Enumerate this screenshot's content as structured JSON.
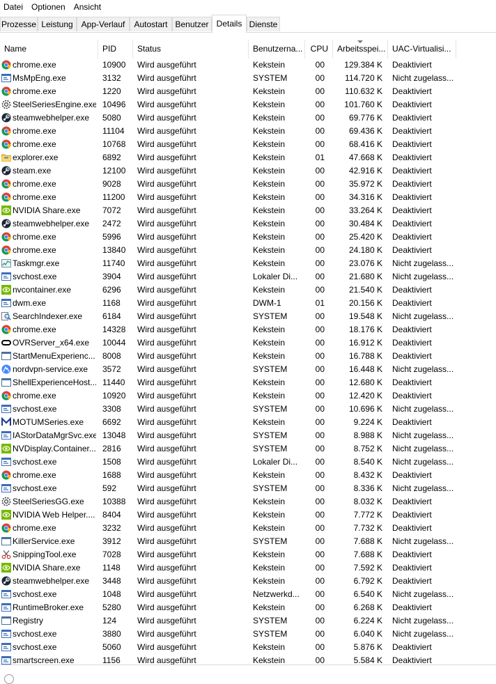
{
  "menu": [
    "Datei",
    "Optionen",
    "Ansicht"
  ],
  "tabs": [
    "Prozesse",
    "Leistung",
    "App-Verlauf",
    "Autostart",
    "Benutzer",
    "Details",
    "Dienste"
  ],
  "active_tab": "Details",
  "columns": [
    "Name",
    "PID",
    "Status",
    "Benutzerna...",
    "CPU",
    "Arbeitsspei...",
    "UAC-Virtualisi..."
  ],
  "sort_column": "Arbeitsspei...",
  "processes": [
    {
      "name": "chrome.exe",
      "pid": "10900",
      "status": "Wird ausgeführt",
      "user": "Kekstein",
      "cpu": "00",
      "mem": "129.384 K",
      "uac": "Deaktiviert",
      "icon": "chrome-icon"
    },
    {
      "name": "MsMpEng.exe",
      "pid": "3132",
      "status": "Wird ausgeführt",
      "user": "SYSTEM",
      "cpu": "00",
      "mem": "114.720 K",
      "uac": "Nicht zugelass...",
      "icon": "service-icon"
    },
    {
      "name": "chrome.exe",
      "pid": "1220",
      "status": "Wird ausgeführt",
      "user": "Kekstein",
      "cpu": "00",
      "mem": "110.632 K",
      "uac": "Deaktiviert",
      "icon": "chrome-icon"
    },
    {
      "name": "SteelSeriesEngine.exe",
      "pid": "10496",
      "status": "Wird ausgeführt",
      "user": "Kekstein",
      "cpu": "00",
      "mem": "101.760 K",
      "uac": "Deaktiviert",
      "icon": "steelseries-icon"
    },
    {
      "name": "steamwebhelper.exe",
      "pid": "5080",
      "status": "Wird ausgeführt",
      "user": "Kekstein",
      "cpu": "00",
      "mem": "69.776 K",
      "uac": "Deaktiviert",
      "icon": "steam-icon"
    },
    {
      "name": "chrome.exe",
      "pid": "11104",
      "status": "Wird ausgeführt",
      "user": "Kekstein",
      "cpu": "00",
      "mem": "69.436 K",
      "uac": "Deaktiviert",
      "icon": "chrome-icon"
    },
    {
      "name": "chrome.exe",
      "pid": "10768",
      "status": "Wird ausgeführt",
      "user": "Kekstein",
      "cpu": "00",
      "mem": "68.416 K",
      "uac": "Deaktiviert",
      "icon": "chrome-icon"
    },
    {
      "name": "explorer.exe",
      "pid": "6892",
      "status": "Wird ausgeführt",
      "user": "Kekstein",
      "cpu": "01",
      "mem": "47.668 K",
      "uac": "Deaktiviert",
      "icon": "folder-icon"
    },
    {
      "name": "steam.exe",
      "pid": "12100",
      "status": "Wird ausgeführt",
      "user": "Kekstein",
      "cpu": "00",
      "mem": "42.916 K",
      "uac": "Deaktiviert",
      "icon": "steam-icon"
    },
    {
      "name": "chrome.exe",
      "pid": "9028",
      "status": "Wird ausgeführt",
      "user": "Kekstein",
      "cpu": "00",
      "mem": "35.972 K",
      "uac": "Deaktiviert",
      "icon": "chrome-icon"
    },
    {
      "name": "chrome.exe",
      "pid": "11200",
      "status": "Wird ausgeführt",
      "user": "Kekstein",
      "cpu": "00",
      "mem": "34.316 K",
      "uac": "Deaktiviert",
      "icon": "chrome-icon"
    },
    {
      "name": "NVIDIA Share.exe",
      "pid": "7072",
      "status": "Wird ausgeführt",
      "user": "Kekstein",
      "cpu": "00",
      "mem": "33.264 K",
      "uac": "Deaktiviert",
      "icon": "nvidia-icon"
    },
    {
      "name": "steamwebhelper.exe",
      "pid": "2472",
      "status": "Wird ausgeführt",
      "user": "Kekstein",
      "cpu": "00",
      "mem": "30.484 K",
      "uac": "Deaktiviert",
      "icon": "steam-icon"
    },
    {
      "name": "chrome.exe",
      "pid": "5996",
      "status": "Wird ausgeführt",
      "user": "Kekstein",
      "cpu": "00",
      "mem": "25.420 K",
      "uac": "Deaktiviert",
      "icon": "chrome-icon"
    },
    {
      "name": "chrome.exe",
      "pid": "13840",
      "status": "Wird ausgeführt",
      "user": "Kekstein",
      "cpu": "00",
      "mem": "24.180 K",
      "uac": "Deaktiviert",
      "icon": "chrome-icon"
    },
    {
      "name": "Taskmgr.exe",
      "pid": "11740",
      "status": "Wird ausgeführt",
      "user": "Kekstein",
      "cpu": "00",
      "mem": "23.076 K",
      "uac": "Nicht zugelass...",
      "icon": "taskmgr-icon"
    },
    {
      "name": "svchost.exe",
      "pid": "3904",
      "status": "Wird ausgeführt",
      "user": "Lokaler Di...",
      "cpu": "00",
      "mem": "21.680 K",
      "uac": "Nicht zugelass...",
      "icon": "service-icon"
    },
    {
      "name": "nvcontainer.exe",
      "pid": "6296",
      "status": "Wird ausgeführt",
      "user": "Kekstein",
      "cpu": "00",
      "mem": "21.540 K",
      "uac": "Deaktiviert",
      "icon": "nvidia-icon"
    },
    {
      "name": "dwm.exe",
      "pid": "1168",
      "status": "Wird ausgeführt",
      "user": "DWM-1",
      "cpu": "01",
      "mem": "20.156 K",
      "uac": "Deaktiviert",
      "icon": "service-icon"
    },
    {
      "name": "SearchIndexer.exe",
      "pid": "6184",
      "status": "Wird ausgeführt",
      "user": "SYSTEM",
      "cpu": "00",
      "mem": "19.548 K",
      "uac": "Nicht zugelass...",
      "icon": "search-indexer-icon"
    },
    {
      "name": "chrome.exe",
      "pid": "14328",
      "status": "Wird ausgeführt",
      "user": "Kekstein",
      "cpu": "00",
      "mem": "18.176 K",
      "uac": "Deaktiviert",
      "icon": "chrome-icon"
    },
    {
      "name": "OVRServer_x64.exe",
      "pid": "10044",
      "status": "Wird ausgeführt",
      "user": "Kekstein",
      "cpu": "00",
      "mem": "16.912 K",
      "uac": "Deaktiviert",
      "icon": "oculus-icon"
    },
    {
      "name": "StartMenuExperienc...",
      "pid": "8008",
      "status": "Wird ausgeführt",
      "user": "Kekstein",
      "cpu": "00",
      "mem": "16.788 K",
      "uac": "Deaktiviert",
      "icon": "window-icon"
    },
    {
      "name": "nordvpn-service.exe",
      "pid": "3572",
      "status": "Wird ausgeführt",
      "user": "SYSTEM",
      "cpu": "00",
      "mem": "16.448 K",
      "uac": "Nicht zugelass...",
      "icon": "nordvpn-icon"
    },
    {
      "name": "ShellExperienceHost....",
      "pid": "11440",
      "status": "Wird ausgeführt",
      "user": "Kekstein",
      "cpu": "00",
      "mem": "12.680 K",
      "uac": "Deaktiviert",
      "icon": "window-icon"
    },
    {
      "name": "chrome.exe",
      "pid": "10920",
      "status": "Wird ausgeführt",
      "user": "Kekstein",
      "cpu": "00",
      "mem": "12.420 K",
      "uac": "Deaktiviert",
      "icon": "chrome-icon"
    },
    {
      "name": "svchost.exe",
      "pid": "3308",
      "status": "Wird ausgeführt",
      "user": "SYSTEM",
      "cpu": "00",
      "mem": "10.696 K",
      "uac": "Nicht zugelass...",
      "icon": "service-icon"
    },
    {
      "name": "MOTUMSeries.exe",
      "pid": "6692",
      "status": "Wird ausgeführt",
      "user": "Kekstein",
      "cpu": "00",
      "mem": "9.224 K",
      "uac": "Deaktiviert",
      "icon": "motu-icon"
    },
    {
      "name": "IAStorDataMgrSvc.exe",
      "pid": "13048",
      "status": "Wird ausgeführt",
      "user": "SYSTEM",
      "cpu": "00",
      "mem": "8.988 K",
      "uac": "Nicht zugelass...",
      "icon": "service-icon"
    },
    {
      "name": "NVDisplay.Container....",
      "pid": "2816",
      "status": "Wird ausgeführt",
      "user": "SYSTEM",
      "cpu": "00",
      "mem": "8.752 K",
      "uac": "Nicht zugelass...",
      "icon": "nvidia-icon"
    },
    {
      "name": "svchost.exe",
      "pid": "1508",
      "status": "Wird ausgeführt",
      "user": "Lokaler Di...",
      "cpu": "00",
      "mem": "8.540 K",
      "uac": "Nicht zugelass...",
      "icon": "service-icon"
    },
    {
      "name": "chrome.exe",
      "pid": "1688",
      "status": "Wird ausgeführt",
      "user": "Kekstein",
      "cpu": "00",
      "mem": "8.432 K",
      "uac": "Deaktiviert",
      "icon": "chrome-icon"
    },
    {
      "name": "svchost.exe",
      "pid": "592",
      "status": "Wird ausgeführt",
      "user": "SYSTEM",
      "cpu": "00",
      "mem": "8.336 K",
      "uac": "Nicht zugelass...",
      "icon": "service-icon"
    },
    {
      "name": "SteelSeriesGG.exe",
      "pid": "10388",
      "status": "Wird ausgeführt",
      "user": "Kekstein",
      "cpu": "00",
      "mem": "8.032 K",
      "uac": "Deaktiviert",
      "icon": "steelseries-icon"
    },
    {
      "name": "NVIDIA Web Helper....",
      "pid": "8404",
      "status": "Wird ausgeführt",
      "user": "Kekstein",
      "cpu": "00",
      "mem": "7.772 K",
      "uac": "Deaktiviert",
      "icon": "nvidia-icon"
    },
    {
      "name": "chrome.exe",
      "pid": "3232",
      "status": "Wird ausgeführt",
      "user": "Kekstein",
      "cpu": "00",
      "mem": "7.732 K",
      "uac": "Deaktiviert",
      "icon": "chrome-icon"
    },
    {
      "name": "KillerService.exe",
      "pid": "3912",
      "status": "Wird ausgeführt",
      "user": "SYSTEM",
      "cpu": "00",
      "mem": "7.688 K",
      "uac": "Nicht zugelass...",
      "icon": "window-icon"
    },
    {
      "name": "SnippingTool.exe",
      "pid": "7028",
      "status": "Wird ausgeführt",
      "user": "Kekstein",
      "cpu": "00",
      "mem": "7.688 K",
      "uac": "Deaktiviert",
      "icon": "scissors-icon"
    },
    {
      "name": "NVIDIA Share.exe",
      "pid": "1148",
      "status": "Wird ausgeführt",
      "user": "Kekstein",
      "cpu": "00",
      "mem": "7.592 K",
      "uac": "Deaktiviert",
      "icon": "nvidia-icon"
    },
    {
      "name": "steamwebhelper.exe",
      "pid": "3448",
      "status": "Wird ausgeführt",
      "user": "Kekstein",
      "cpu": "00",
      "mem": "6.792 K",
      "uac": "Deaktiviert",
      "icon": "steam-icon"
    },
    {
      "name": "svchost.exe",
      "pid": "1048",
      "status": "Wird ausgeführt",
      "user": "Netzwerkd...",
      "cpu": "00",
      "mem": "6.540 K",
      "uac": "Nicht zugelass...",
      "icon": "service-icon"
    },
    {
      "name": "RuntimeBroker.exe",
      "pid": "5280",
      "status": "Wird ausgeführt",
      "user": "Kekstein",
      "cpu": "00",
      "mem": "6.268 K",
      "uac": "Deaktiviert",
      "icon": "service-icon"
    },
    {
      "name": "Registry",
      "pid": "124",
      "status": "Wird ausgeführt",
      "user": "SYSTEM",
      "cpu": "00",
      "mem": "6.224 K",
      "uac": "Nicht zugelass...",
      "icon": "window-icon"
    },
    {
      "name": "svchost.exe",
      "pid": "3880",
      "status": "Wird ausgeführt",
      "user": "SYSTEM",
      "cpu": "00",
      "mem": "6.040 K",
      "uac": "Nicht zugelass...",
      "icon": "service-icon"
    },
    {
      "name": "svchost.exe",
      "pid": "5060",
      "status": "Wird ausgeführt",
      "user": "Kekstein",
      "cpu": "00",
      "mem": "5.876 K",
      "uac": "Deaktiviert",
      "icon": "service-icon"
    },
    {
      "name": "smartscreen.exe",
      "pid": "1156",
      "status": "Wird ausgeführt",
      "user": "Kekstein",
      "cpu": "00",
      "mem": "5.584 K",
      "uac": "Deaktiviert",
      "icon": "service-icon"
    }
  ]
}
